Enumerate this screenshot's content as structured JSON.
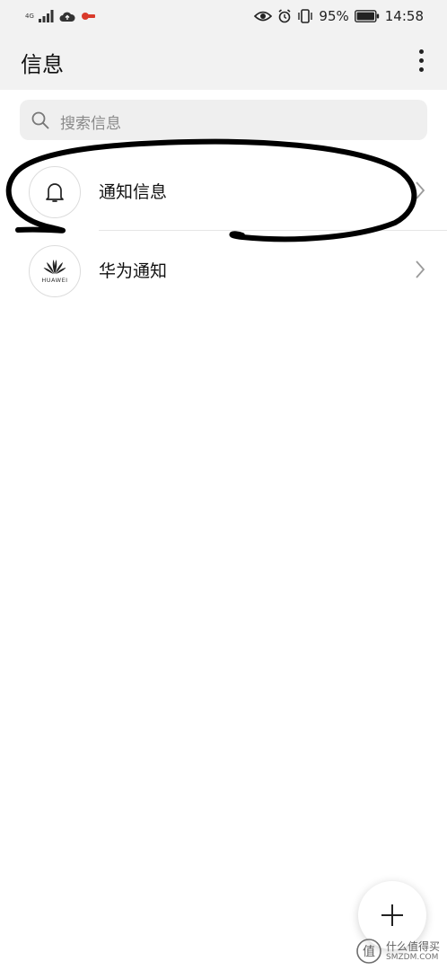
{
  "status_bar": {
    "network_label": "4G",
    "battery_percent": "95%",
    "time": "14:58"
  },
  "header": {
    "title": "信息"
  },
  "search": {
    "placeholder": "搜索信息"
  },
  "conversations": [
    {
      "label": "通知信息",
      "avatar_icon": "bell-icon"
    },
    {
      "label": "华为通知",
      "avatar_icon": "huawei-logo-icon",
      "avatar_text": "HUAWEI"
    }
  ],
  "fab": {
    "icon": "plus-icon"
  },
  "watermark": {
    "logo_char": "值",
    "text": "什么值得买",
    "subtext": "SMZDM.COM"
  },
  "colors": {
    "header_bg": "#f2f2f2",
    "search_bg": "#efefef",
    "annotation_stroke": "#000000"
  }
}
